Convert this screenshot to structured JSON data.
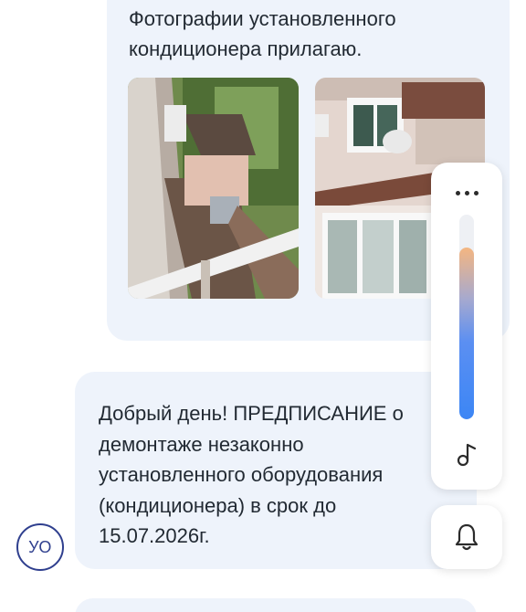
{
  "messages": {
    "first": {
      "text": "Фотографии установленного кондиционера прилагаю.",
      "photos": [
        {
          "name": "balcony-air-conditioner-photo"
        },
        {
          "name": "building-facade-air-conditioner-photo"
        }
      ]
    },
    "second": {
      "text": "Добрый день! ПРЕДПИСАНИЕ о демонтаже незаконно установленного оборудования (кондиционера) в срок до 15.07.2026г."
    }
  },
  "sender": {
    "avatar_initials": "УО"
  },
  "volume_panel": {
    "more_icon": "more-dots-icon",
    "level": 0.84,
    "mode_icon": "music-note-icon",
    "accent_top": "#f4b681",
    "accent_bottom": "#3c86f5"
  },
  "notifications": {
    "icon": "bell-icon"
  }
}
